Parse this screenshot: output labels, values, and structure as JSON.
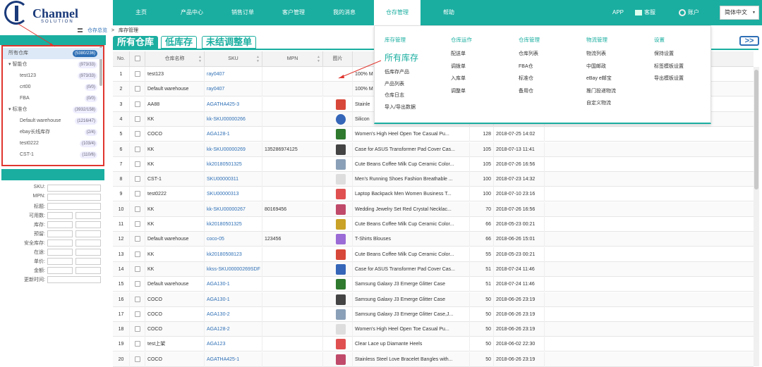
{
  "header": {
    "logo_text": "Channel",
    "logo_sub": "SOLUTION",
    "nav": [
      "主页",
      "产品中心",
      "销售订单",
      "客户管理",
      "我的消息",
      "仓存管理",
      "帮助"
    ],
    "active_nav": "仓存管理",
    "app": "APP",
    "service": "客服",
    "account": "账户",
    "language": "简体中文"
  },
  "breadcrumb": {
    "parent": "仓存总览",
    "sep": ">",
    "current": "库存管理"
  },
  "tabs": [
    "所有仓库",
    "低库存",
    "未结调整单"
  ],
  "active_tab": "所有仓库",
  "expand_label": ">>",
  "sidebar": {
    "tree": [
      {
        "label": "所有仓库",
        "count": "(5380/236)",
        "indent": 0,
        "selected": true
      },
      {
        "label": "▾ 智能仓",
        "count": "(973/33)",
        "indent": 0
      },
      {
        "label": "test123",
        "count": "(973/33)",
        "indent": 1
      },
      {
        "label": "crt00",
        "count": "(0/0)",
        "indent": 1
      },
      {
        "label": "FBA",
        "count": "(0/0)",
        "indent": 1
      },
      {
        "label": "▾ 标准仓",
        "count": "(3932/158)",
        "indent": 0
      },
      {
        "label": "Default warehouse",
        "count": "(1216/47)",
        "indent": 1
      },
      {
        "label": "ebay长线库存",
        "count": "(2/4)",
        "indent": 1
      },
      {
        "label": "test0222",
        "count": "(103/4)",
        "indent": 1
      },
      {
        "label": "CST-1",
        "count": "(110/6)",
        "indent": 1
      }
    ],
    "filters": [
      "SKU:",
      "MPN:",
      "标题:",
      "可用数:",
      "库存:",
      "预留:",
      "安全库存:",
      "在途:",
      "单价:",
      "金额:",
      "更新时间:"
    ]
  },
  "table": {
    "columns": [
      "No.",
      "",
      "仓库名称",
      "SKU",
      "MPN",
      "图片",
      "",
      "",
      ""
    ],
    "rows": [
      {
        "no": "1",
        "wh": "test123",
        "sku": "ray0407",
        "mpn": "",
        "title": "100% M",
        "qty": "",
        "time": ""
      },
      {
        "no": "2",
        "wh": "Default warehouse",
        "sku": "ray0407",
        "mpn": "",
        "title": "100% M",
        "qty": "",
        "time": ""
      },
      {
        "no": "3",
        "wh": "AA88",
        "sku": "AGATHA425-3",
        "mpn": "",
        "title": "Stainle",
        "qty": "",
        "time": ""
      },
      {
        "no": "4",
        "wh": "KK",
        "sku": "kk-SKU00000266",
        "mpn": "",
        "title": "Silicon",
        "qty": "",
        "time": ""
      },
      {
        "no": "5",
        "wh": "COCO",
        "sku": "AGA128-1",
        "mpn": "",
        "title": "Women's High Heel Open Toe Casual Pu...",
        "qty": "128",
        "time": "2018-07-25 14:02"
      },
      {
        "no": "6",
        "wh": "KK",
        "sku": "kk-SKU00000269",
        "mpn": "135286974125",
        "title": "Case for ASUS Transformer Pad Cover Cas...",
        "qty": "105",
        "time": "2018-07-13 11:41"
      },
      {
        "no": "7",
        "wh": "KK",
        "sku": "kk20180501325",
        "mpn": "",
        "title": "Cute Beans Coffee Milk Cup Ceramic Color...",
        "qty": "105",
        "time": "2018-07-26 16:56"
      },
      {
        "no": "8",
        "wh": "CST-1",
        "sku": "SKU00000311",
        "mpn": "",
        "title": "Men's Running Shoes Fashion Breathable ...",
        "qty": "100",
        "time": "2018-07-23 14:32"
      },
      {
        "no": "9",
        "wh": "test0222",
        "sku": "SKU00000313",
        "mpn": "",
        "title": "Laptop Backpack Men Women Business T...",
        "qty": "100",
        "time": "2018-07-10 23:16"
      },
      {
        "no": "10",
        "wh": "KK",
        "sku": "kk-SKU00000267",
        "mpn": "80169456",
        "title": "Wedding Jewelry Set Red Crystal Necklac...",
        "qty": "70",
        "time": "2018-07-26 16:56"
      },
      {
        "no": "11",
        "wh": "KK",
        "sku": "kk20180501325",
        "mpn": "",
        "title": "Cute Beans Coffee Milk Cup Ceramic Color...",
        "qty": "66",
        "time": "2018-05-23 00:21"
      },
      {
        "no": "12",
        "wh": "Default warehouse",
        "sku": "coco-05",
        "mpn": "123456",
        "title": "T-Shirts Blouses",
        "qty": "66",
        "time": "2018-06-26 15:01"
      },
      {
        "no": "13",
        "wh": "KK",
        "sku": "kk20180508123",
        "mpn": "",
        "title": "Cute Beans Coffee Milk Cup Ceramic Color...",
        "qty": "55",
        "time": "2018-05-23 00:21"
      },
      {
        "no": "14",
        "wh": "KK",
        "sku": "kkss-SKU00000269SDF",
        "mpn": "",
        "title": "Case for ASUS Transformer Pad Cover Cas...",
        "qty": "51",
        "time": "2018-07-24 11:46"
      },
      {
        "no": "15",
        "wh": "Default warehouse",
        "sku": "AGA130-1",
        "mpn": "",
        "title": "Samsung Galaxy J3 Emerge Glitter Case",
        "qty": "51",
        "time": "2018-07-24 11:46"
      },
      {
        "no": "16",
        "wh": "COCO",
        "sku": "AGA130-1",
        "mpn": "",
        "title": "Samsung Galaxy J3 Emerge Glitter Case",
        "qty": "50",
        "time": "2018-06-26 23:19"
      },
      {
        "no": "17",
        "wh": "COCO",
        "sku": "AGA130-2",
        "mpn": "",
        "title": "Samsung Galaxy J3 Emerge Glitter Case,J...",
        "qty": "50",
        "time": "2018-06-26 23:19"
      },
      {
        "no": "18",
        "wh": "COCO",
        "sku": "AGA128-2",
        "mpn": "",
        "title": "Women's High Heel Open Toe Casual Pu...",
        "qty": "50",
        "time": "2018-06-26 23:19"
      },
      {
        "no": "19",
        "wh": "test上架",
        "sku": "AGA123",
        "mpn": "",
        "title": "Clear Lace up Diamante Heels",
        "qty": "50",
        "time": "2018-06-02 22:30"
      },
      {
        "no": "20",
        "wh": "COCO",
        "sku": "AGATHA425-1",
        "mpn": "",
        "title": "Stainless Steel Love Bracelet Bangles with...",
        "qty": "50",
        "time": "2018-06-26 23:19"
      }
    ]
  },
  "mega_menu": {
    "columns": [
      {
        "heading": "库存管理",
        "items": [
          "所有库存",
          "低库存产品",
          "产品列表",
          "仓库日志",
          "导入/导出数据"
        ]
      },
      {
        "heading": "仓库运作",
        "items": [
          "配送单",
          "调拨单",
          "入库单",
          "调整单"
        ]
      },
      {
        "heading": "仓库管理",
        "items": [
          "仓库列表",
          "FBA仓",
          "标准仓",
          "备用仓"
        ]
      },
      {
        "heading": "物流管理",
        "items": [
          "物流列表",
          "中国邮政",
          "eBay e邮宝",
          "推门投递物流",
          "自定义物流"
        ]
      },
      {
        "heading": "设置",
        "items": [
          "保持设置",
          "标签模板设置",
          "导出模板设置"
        ]
      }
    ]
  },
  "colors": {
    "brand": "#1aaea0",
    "link": "#2e6fb5",
    "highlight": "#e0362f"
  }
}
